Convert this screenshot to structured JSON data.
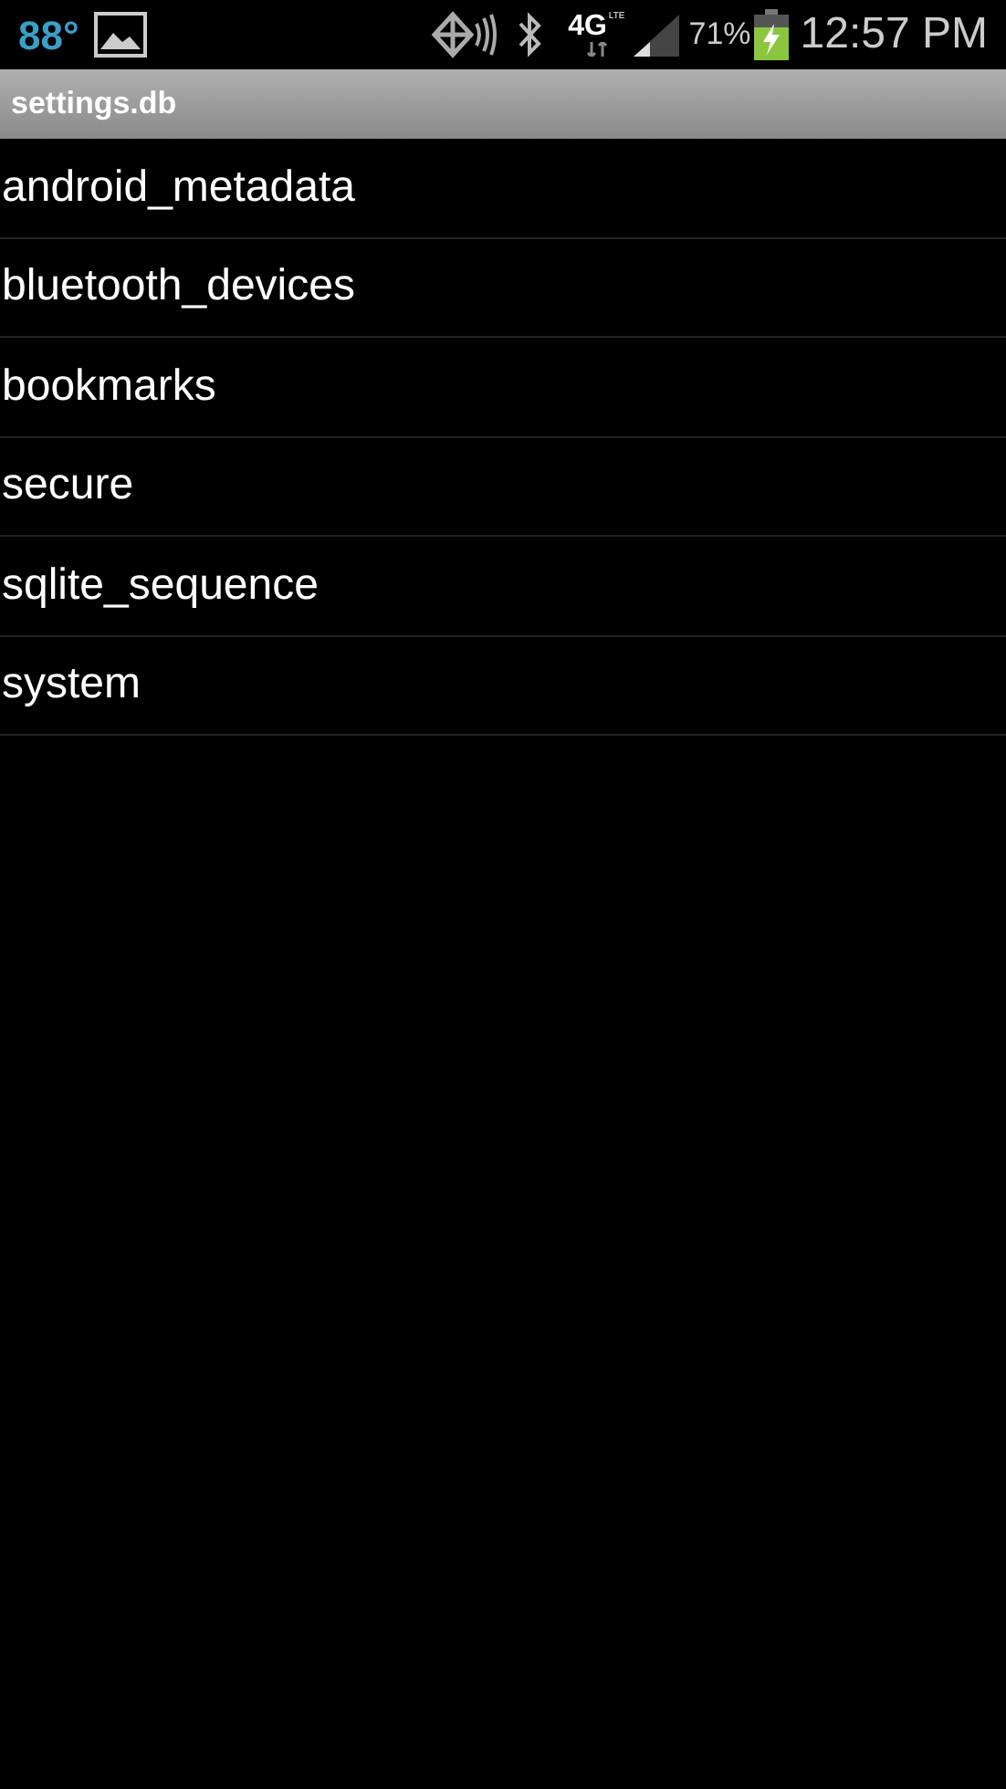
{
  "status_bar": {
    "temperature": "88°",
    "network_type": "4G",
    "network_sub": "LTE",
    "battery": "71%",
    "time": "12:57 PM"
  },
  "title_bar": {
    "title": "settings.db"
  },
  "tables": [
    {
      "name": "android_metadata"
    },
    {
      "name": "bluetooth_devices"
    },
    {
      "name": "bookmarks"
    },
    {
      "name": "secure"
    },
    {
      "name": "sqlite_sequence"
    },
    {
      "name": "system"
    }
  ]
}
